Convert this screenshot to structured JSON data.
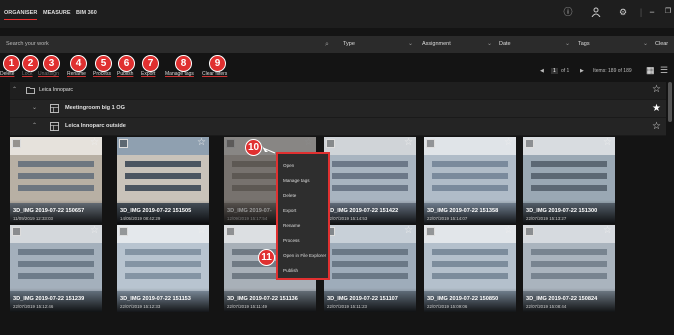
{
  "header": {
    "tabs": [
      "ORGANISER",
      "MEASURE",
      "BIM 360"
    ],
    "icons": [
      "info-icon",
      "user-icon",
      "gear-icon",
      "minimize-icon",
      "restore-icon"
    ]
  },
  "filters": {
    "search_placeholder": "Search your work",
    "type": "Type",
    "assignment": "Assignment",
    "date": "Date",
    "tags": "Tags",
    "clear": "Clear"
  },
  "toolbar": {
    "buttons": [
      {
        "label": "Delete",
        "n": "1",
        "enabled": true
      },
      {
        "label": "Lock",
        "n": "2",
        "enabled": false
      },
      {
        "label": "Unassign",
        "n": "3",
        "enabled": false
      },
      {
        "label": "Rename",
        "n": "4",
        "enabled": true
      },
      {
        "label": "Process",
        "n": "5",
        "enabled": true
      },
      {
        "label": "Publish",
        "n": "6",
        "enabled": true
      },
      {
        "label": "Export",
        "n": "7",
        "enabled": true
      },
      {
        "label": "Manage tags",
        "n": "8",
        "enabled": true
      },
      {
        "label": "Clear filters",
        "n": "9",
        "enabled": true
      }
    ],
    "pager": {
      "page": "1",
      "of": "of 1",
      "items": "Items: 189 of 189"
    }
  },
  "tree": {
    "root": "Leica Innoparc",
    "group1": "Meetingroom big 1 OG",
    "group2": "Leica Innoparc outside"
  },
  "cards": [
    {
      "name": "3D_IMG 2019-07-22 150657",
      "date": "11/09/2019 12:33:03"
    },
    {
      "name": "3D_IMG 2019-07-22 151505",
      "date": "14/05/2019 08:42:29"
    },
    {
      "name": "3D_IMG 2019-07-",
      "date": "12/09/2019 15:17:54"
    },
    {
      "name": "3D_IMG 2019-07-22 151422",
      "date": "22/07/2019 15:14:53"
    },
    {
      "name": "3D_IMG 2019-07-22 151358",
      "date": "22/07/2019 15:14:07"
    },
    {
      "name": "3D_IMG 2019-07-22 151300",
      "date": "22/07/2019 15:13:27"
    },
    {
      "name": "3D_IMG 2019-07-22 151239",
      "date": "22/07/2019 15:12:46"
    },
    {
      "name": "3D_IMG 2019-07-22 151153",
      "date": "22/07/2019 15:12:33"
    },
    {
      "name": "3D_IMG 2019-07-22 151136",
      "date": "22/07/2019 15:11:49"
    },
    {
      "name": "3D_IMG 2019-07-22 151107",
      "date": "22/07/2019 15:11:23"
    },
    {
      "name": "3D_IMG 2019-07-22 150850",
      "date": "22/07/2019 15:09:06"
    },
    {
      "name": "3D_IMG 2019-07-22 150824",
      "date": "22/07/2019 15:08:44"
    }
  ],
  "context_menu": {
    "items": [
      "Open",
      "Manage tags",
      "Delete",
      "Export",
      "Rename",
      "Process",
      "Open in File Explorer",
      "Publish"
    ]
  },
  "callouts": {
    "menu_pointer": "10",
    "menu_items": "11"
  },
  "colors": {
    "accent": "#e03030",
    "background": "#141414"
  }
}
